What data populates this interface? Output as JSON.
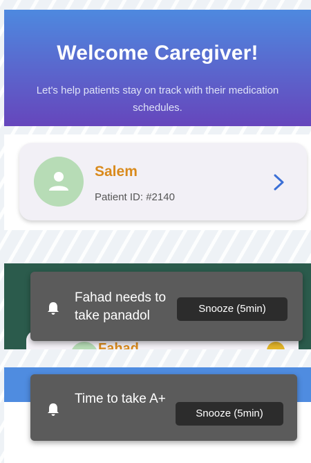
{
  "welcome": {
    "title": "Welcome Caregiver!",
    "subtitle": "Let's help patients stay on track with their medication schedules."
  },
  "patient_card": {
    "name": "Salem",
    "patient_id": "Patient ID: #2140",
    "avatar_icon": "person-icon",
    "chevron_icon": "chevron-right-icon",
    "name_color": "#d98a1c"
  },
  "notification_1": {
    "message": "Fahad needs to take panadol",
    "snooze_label": "Snooze (5min)",
    "underlying_name": "Fahad",
    "icon": "bell-icon"
  },
  "notification_2": {
    "message": "Time to take A+",
    "snooze_label": "Snooze (5min)",
    "icon": "bell-icon"
  },
  "colors": {
    "header_top": "#4e89df",
    "header_bottom": "#6646bc",
    "toast_bg": "#5b5b5b",
    "snooze_bg": "#2c2c2c",
    "green_background": "#2b5b4c"
  }
}
